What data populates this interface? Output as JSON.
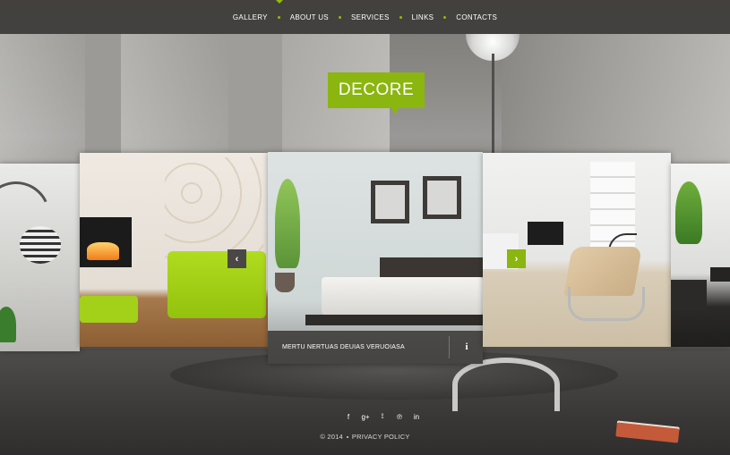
{
  "nav": {
    "items": [
      {
        "label": "GALLERY"
      },
      {
        "label": "ABOUT US"
      },
      {
        "label": "SERVICES"
      },
      {
        "label": "LINKS"
      },
      {
        "label": "CONTACTS"
      }
    ],
    "active": "GALLERY"
  },
  "logo": {
    "text": "DECORE"
  },
  "gallery": {
    "caption": "MERTU NERTUAS DEUIAS VERUOIASA",
    "info_icon": "i",
    "prev_icon": "chevron-left-icon",
    "next_icon": "chevron-right-icon",
    "prev_glyph": "‹",
    "next_glyph": "›"
  },
  "footer": {
    "social": [
      {
        "name": "facebook-icon",
        "glyph": "f"
      },
      {
        "name": "google-plus-icon",
        "glyph": "g+"
      },
      {
        "name": "rss-icon",
        "glyph": "⟟"
      },
      {
        "name": "pinterest-icon",
        "glyph": "℗"
      },
      {
        "name": "linkedin-icon",
        "glyph": "in"
      }
    ],
    "copyright": "© 2014",
    "privacy": "PRIVACY POLICY"
  },
  "colors": {
    "accent": "#8bb50f",
    "nav_bg": "#3e3c3a",
    "caption_bg": "#3c3a38"
  }
}
